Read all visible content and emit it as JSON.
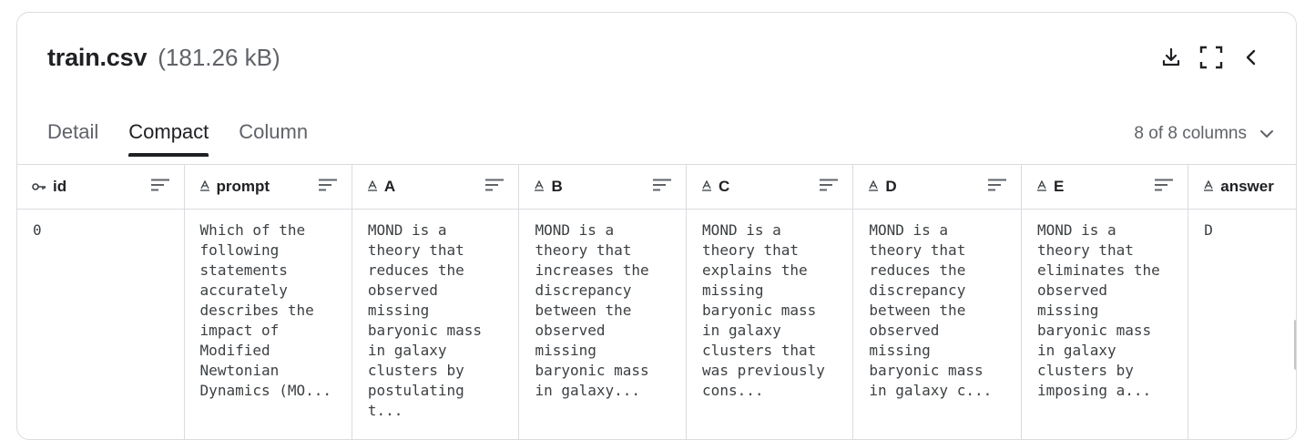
{
  "file": {
    "name": "train.csv",
    "size": "(181.26 kB)"
  },
  "actions": [
    {
      "icon": "download-icon"
    },
    {
      "icon": "fullscreen-icon"
    },
    {
      "icon": "chevron-left-icon"
    }
  ],
  "tabs": [
    {
      "label": "Detail",
      "active": false
    },
    {
      "label": "Compact",
      "active": true
    },
    {
      "label": "Column",
      "active": false
    }
  ],
  "column_selector": {
    "label": "8 of 8 columns"
  },
  "table": {
    "columns": [
      {
        "name": "id",
        "type_icon": "key-icon"
      },
      {
        "name": "prompt",
        "type_icon": "text-type-icon"
      },
      {
        "name": "A",
        "type_icon": "text-type-icon"
      },
      {
        "name": "B",
        "type_icon": "text-type-icon"
      },
      {
        "name": "C",
        "type_icon": "text-type-icon"
      },
      {
        "name": "D",
        "type_icon": "text-type-icon"
      },
      {
        "name": "E",
        "type_icon": "text-type-icon"
      },
      {
        "name": "answer",
        "type_icon": "text-type-icon"
      }
    ],
    "rows": [
      [
        "0",
        "Which of the\nfollowing\nstatements\naccurately\ndescribes the\nimpact of\nModified\nNewtonian\nDynamics (MO...",
        "MOND is a\ntheory that\nreduces the\nobserved\nmissing\nbaryonic mass\nin galaxy\nclusters by\npostulating\nt...",
        "MOND is a\ntheory that\nincreases the\ndiscrepancy\nbetween the\nobserved\nmissing\nbaryonic mass\nin galaxy...",
        "MOND is a\ntheory that\nexplains the\nmissing\nbaryonic mass\nin galaxy\nclusters that\nwas previously\ncons...",
        "MOND is a\ntheory that\nreduces the\ndiscrepancy\nbetween the\nobserved\nmissing\nbaryonic mass\nin galaxy c...",
        "MOND is a\ntheory that\neliminates the\nobserved\nmissing\nbaryonic mass\nin galaxy\nclusters by\nimposing a...",
        "D"
      ]
    ]
  }
}
